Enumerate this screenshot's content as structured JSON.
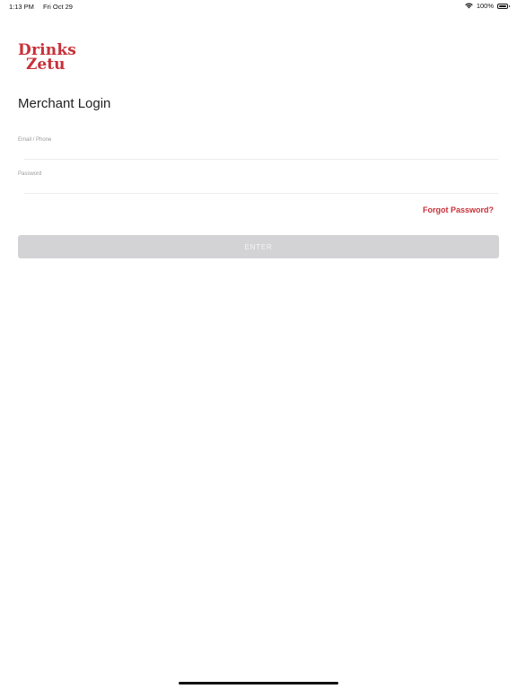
{
  "status_bar": {
    "time": "1:13 PM",
    "date": "Fri Oct 29",
    "battery": "100%",
    "battery_level": 1.0
  },
  "logo": {
    "line1": "Drinks",
    "line2": "Zetu",
    "color": "#c8313a"
  },
  "login": {
    "title": "Merchant Login",
    "email_label": "Email / Phone",
    "email_value": "",
    "password_label": "Password",
    "password_value": "",
    "forgot_label": "Forgot Password?",
    "enter_label": "ENTER"
  },
  "colors": {
    "accent": "#c8313a",
    "button_disabled": "#d3d3d6"
  },
  "icons": {
    "wifi": "wifi-icon",
    "battery": "battery-icon"
  }
}
